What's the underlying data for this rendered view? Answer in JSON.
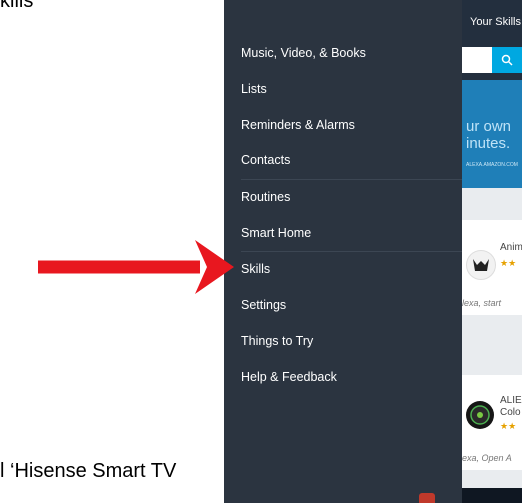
{
  "document": {
    "top_text": "kills",
    "bottom_text": "l ‘Hisense Smart TV"
  },
  "background_app": {
    "tab_label": "Your Skills",
    "banner_text": "ur own\ninutes.",
    "banner_small": "ALEXA.AMAZON.COM",
    "cards": [
      {
        "name": "Anim",
        "stars": "★★",
        "quote": "lexa, start"
      },
      {
        "name": "ALIE\nColo",
        "stars": "★★",
        "quote": "exa, Open A"
      }
    ]
  },
  "drawer": {
    "items": [
      {
        "label": "Music, Video, & Books"
      },
      {
        "label": "Lists"
      },
      {
        "label": "Reminders & Alarms"
      },
      {
        "label": "Contacts"
      },
      {
        "label": "Routines"
      },
      {
        "label": "Smart Home"
      },
      {
        "label": "Skills"
      },
      {
        "label": "Settings"
      },
      {
        "label": "Things to Try"
      },
      {
        "label": "Help & Feedback"
      }
    ]
  },
  "annotation": {
    "arrow_color": "#e8171f",
    "points_to": "Skills"
  },
  "colors": {
    "drawer_bg": "#2b3440",
    "header_bg": "#232f3e",
    "accent": "#00a8e1"
  }
}
